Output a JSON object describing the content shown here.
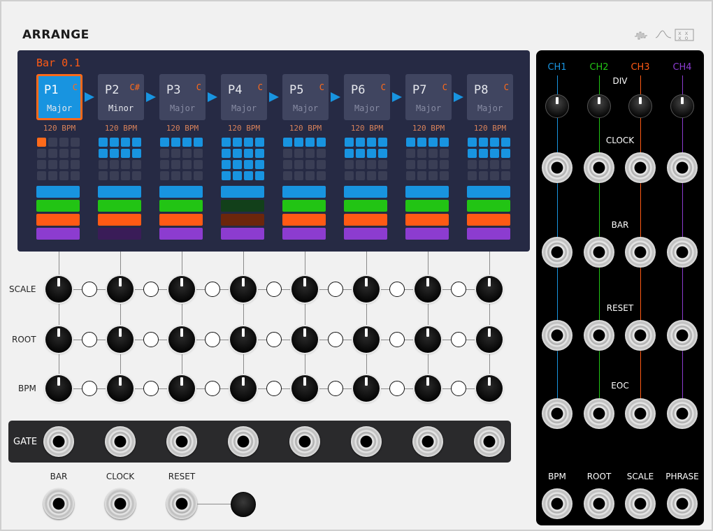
{
  "module": {
    "title": "ARRANGE"
  },
  "display": {
    "bar_label": "Bar 0.1",
    "colors": {
      "active": "#1894e0",
      "accent": "#ff6a1a",
      "ch1": "#1894e0",
      "ch2": "#22c414",
      "ch3": "#ff5a14",
      "ch4": "#8c3cd0"
    },
    "phrases": [
      {
        "name": "P1",
        "root": "C",
        "scale": "Major",
        "bpm": "120 BPM",
        "active": true,
        "lit": true,
        "bars_active": 4,
        "bars_filled": 1,
        "channels_on": [
          true,
          true,
          true,
          true
        ]
      },
      {
        "name": "P2",
        "root": "C#",
        "scale": "Minor",
        "bpm": "120 BPM",
        "active": false,
        "lit": true,
        "bars_active": 4,
        "bars_filled": 8,
        "channels_on": [
          true,
          true,
          true,
          false
        ]
      },
      {
        "name": "P3",
        "root": "C",
        "scale": "Major",
        "bpm": "120 BPM",
        "active": false,
        "lit": false,
        "bars_active": 4,
        "bars_filled": 4,
        "channels_on": [
          true,
          true,
          true,
          true
        ]
      },
      {
        "name": "P4",
        "root": "C",
        "scale": "Major",
        "bpm": "120 BPM",
        "active": false,
        "lit": false,
        "bars_active": 4,
        "bars_filled": 16,
        "channels_on": [
          true,
          false,
          false,
          true
        ]
      },
      {
        "name": "P5",
        "root": "C",
        "scale": "Major",
        "bpm": "120 BPM",
        "active": false,
        "lit": false,
        "bars_active": 4,
        "bars_filled": 4,
        "channels_on": [
          true,
          true,
          true,
          true
        ]
      },
      {
        "name": "P6",
        "root": "C",
        "scale": "Major",
        "bpm": "120 BPM",
        "active": false,
        "lit": false,
        "bars_active": 4,
        "bars_filled": 8,
        "channels_on": [
          true,
          true,
          true,
          true
        ]
      },
      {
        "name": "P7",
        "root": "C",
        "scale": "Major",
        "bpm": "120 BPM",
        "active": false,
        "lit": false,
        "bars_active": 4,
        "bars_filled": 4,
        "channels_on": [
          true,
          true,
          true,
          true
        ]
      },
      {
        "name": "P8",
        "root": "C",
        "scale": "Major",
        "bpm": "120 BPM",
        "active": false,
        "lit": false,
        "bars_active": 4,
        "bars_filled": 8,
        "channels_on": [
          true,
          true,
          true,
          true
        ]
      }
    ]
  },
  "rows": {
    "scale": "SCALE",
    "root": "ROOT",
    "bpm": "BPM",
    "gate": "GATE"
  },
  "inputs": {
    "bar": "BAR",
    "clock": "CLOCK",
    "reset": "RESET"
  },
  "expander": {
    "channels": [
      "CH1",
      "CH2",
      "CH3",
      "CH4"
    ],
    "labels": {
      "div": "DIV",
      "clock": "CLOCK",
      "bar": "BAR",
      "reset": "RESET",
      "eoc": "EOC"
    },
    "bottom": [
      "BPM",
      "ROOT",
      "SCALE",
      "PHRASE"
    ]
  }
}
